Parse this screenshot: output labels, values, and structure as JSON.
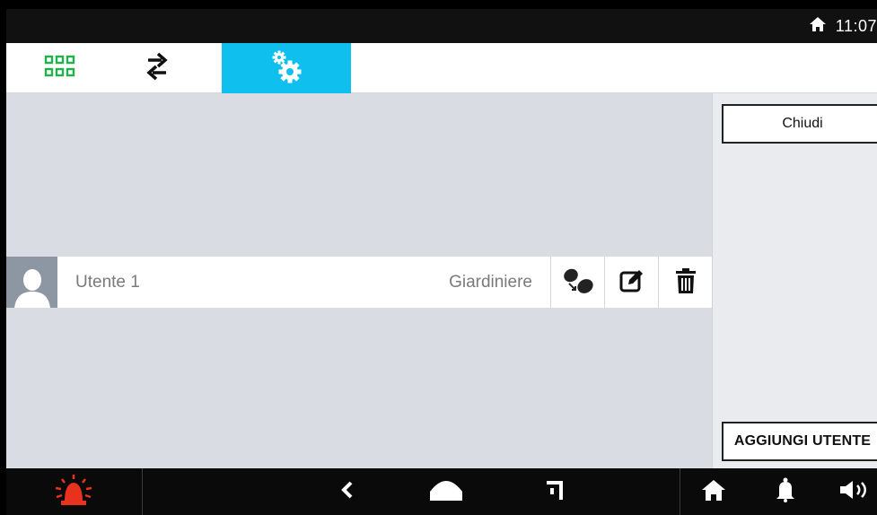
{
  "status_bar": {
    "time": "11:07",
    "icon": "home-icon"
  },
  "tabs": [
    {
      "name": "apps",
      "icon": "grid-icon",
      "active": false
    },
    {
      "name": "transfer",
      "icon": "swap-arrows-icon",
      "active": false
    },
    {
      "name": "settings",
      "icon": "gears-icon",
      "active": true
    }
  ],
  "users": [
    {
      "name": "Utente 1",
      "role": "Giardiniere"
    }
  ],
  "row_actions": [
    "pair-keys-icon",
    "edit-icon",
    "trash-icon"
  ],
  "side_panel": {
    "close_label": "Chiudi",
    "add_user_label": "AGGIUNGI UTENTE"
  },
  "bottom_nav": {
    "items": [
      "alarm-siren-icon",
      "back-icon",
      "home-shape-icon",
      "recent-icon",
      "home-icon",
      "bell-icon",
      "volume-icon"
    ]
  },
  "colors": {
    "accent": "#0fc0ef",
    "grid_icon": "#22b14c",
    "alarm": "#e8321e",
    "main_bg": "#dadce4"
  }
}
